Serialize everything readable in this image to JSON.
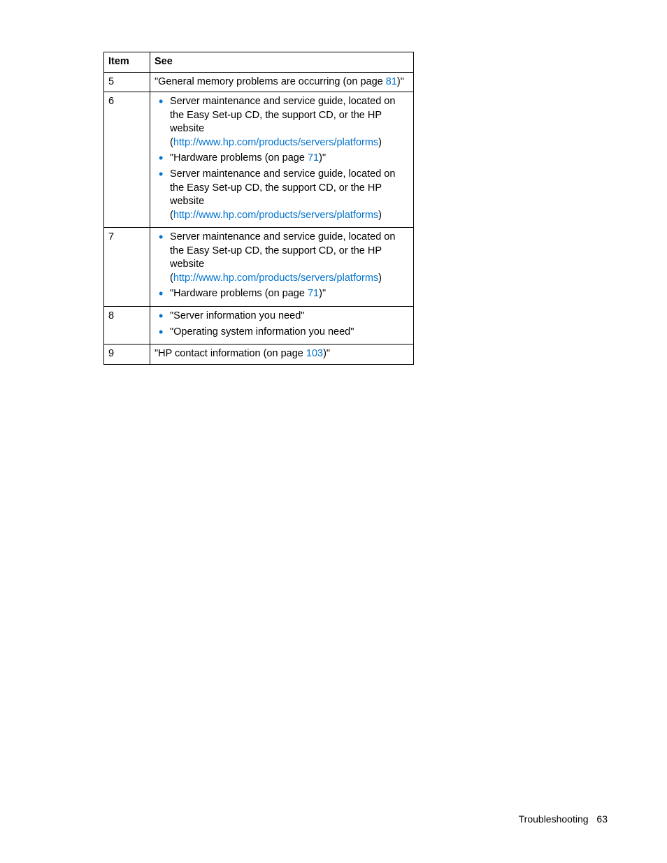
{
  "table": {
    "headers": {
      "item": "Item",
      "see": "See"
    },
    "rows": {
      "r5": {
        "item": "5",
        "text_before": "\"General memory problems are occurring (on page ",
        "link": "81",
        "text_after": ")\""
      },
      "r6": {
        "item": "6",
        "bullets": {
          "b1": {
            "line1": "Server maintenance and service guide, located on the Easy Set-up CD, the support CD, or the HP website (",
            "link": "http://www.hp.com/products/servers/platforms",
            "line3": ")"
          },
          "b2": {
            "text_before": "\"Hardware problems (on page ",
            "link": "71",
            "text_after": ")\""
          },
          "b3": {
            "line1": "Server maintenance and service guide, located on the Easy Set-up CD, the support CD, or the HP website (",
            "link": "http://www.hp.com/products/servers/platforms",
            "line3": ")"
          }
        }
      },
      "r7": {
        "item": "7",
        "bullets": {
          "b1": {
            "line1": "Server maintenance and service guide, located on the Easy Set-up CD, the support CD, or the HP website (",
            "link": "http://www.hp.com/products/servers/platforms",
            "line3": ")"
          },
          "b2": {
            "text_before": "\"Hardware problems (on page ",
            "link": "71",
            "text_after": ")\""
          }
        }
      },
      "r8": {
        "item": "8",
        "bullets": {
          "b1": {
            "text": "\"Server information you need\""
          },
          "b2": {
            "text": "\"Operating system information you need\""
          }
        }
      },
      "r9": {
        "item": "9",
        "text_before": "\"HP contact information (on page ",
        "link": "103",
        "text_after": ")\""
      }
    }
  },
  "footer": {
    "section": "Troubleshooting",
    "page": "63"
  }
}
